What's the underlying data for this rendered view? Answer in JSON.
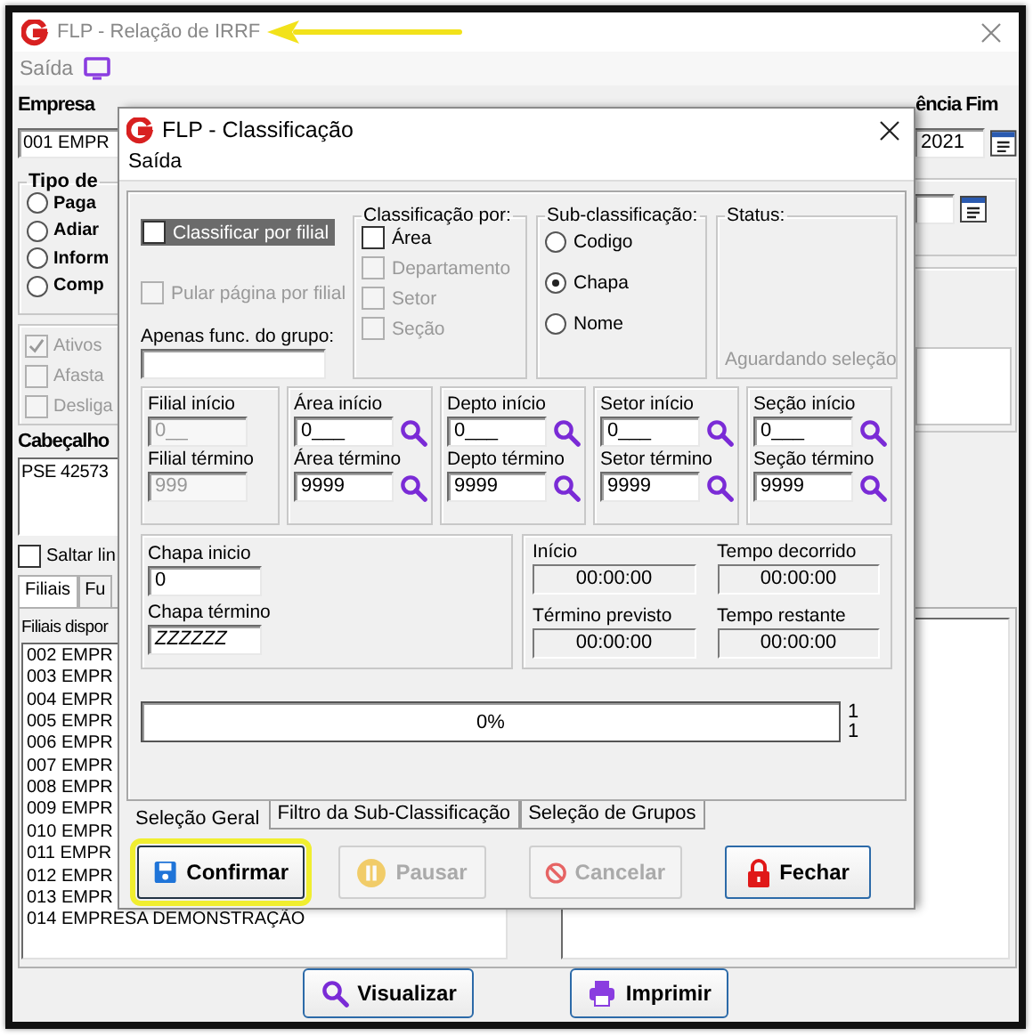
{
  "main_window": {
    "title": "FLP - Relação de IRRF",
    "menu": [
      {
        "label": "Saída"
      }
    ],
    "empresa_label": "Empresa",
    "empresa_value": "001 EMPR",
    "tipo_group": {
      "title": "Tipo de",
      "options": [
        {
          "label": "Paga",
          "selected": false
        },
        {
          "label": "Adiar",
          "selected": false
        },
        {
          "label": "Inform",
          "selected": false
        },
        {
          "label": "Comp",
          "selected": false
        }
      ]
    },
    "situacao": [
      {
        "label": "Ativos",
        "checked": true,
        "disabled": true
      },
      {
        "label": "Afasta",
        "checked": false,
        "disabled": true
      },
      {
        "label": "Desliga",
        "checked": false,
        "disabled": true
      }
    ],
    "cabecalho_label": "Cabeçalho",
    "cabecalho_value": "PSE 42573",
    "saltar": {
      "label": "Saltar lin",
      "checked": false
    },
    "tabs": [
      {
        "label": "Filiais",
        "selected": true
      },
      {
        "label": "Fu",
        "selected": false
      }
    ],
    "list_label": "Filiais dispor",
    "list_items": [
      "002 EMPR",
      "003 EMPR",
      "004 EMPR",
      "005 EMPR",
      "006 EMPR",
      "007 EMPR",
      "008 EMPR",
      "009 EMPR",
      "010 EMPR",
      "011 EMPR",
      "012 EMPR",
      "013 EMPR",
      "014 EMPRESA DEMONSTRAÇÃO"
    ],
    "end_label": "ência Fim",
    "end_value": "2021",
    "buttons": [
      {
        "label": "Visualizar",
        "kind": "search"
      },
      {
        "label": "Imprimir",
        "kind": "print"
      }
    ]
  },
  "dialog": {
    "title": "FLP - Classificação",
    "menu": [
      {
        "label": "Saída"
      }
    ],
    "classificar": {
      "label": "Classificar por filial",
      "checked": false,
      "focused": true
    },
    "pular": {
      "label": "Pular página por filial",
      "checked": false,
      "disabled": true
    },
    "grupo_label": "Apenas func. do grupo:",
    "classificacao": {
      "title": "Classificação por:",
      "options": [
        {
          "label": "Área",
          "checked": false,
          "disabled": false
        },
        {
          "label": "Departamento",
          "checked": false,
          "disabled": true
        },
        {
          "label": "Setor",
          "checked": false,
          "disabled": true
        },
        {
          "label": "Seção",
          "checked": false,
          "disabled": true
        }
      ]
    },
    "sub_classificacao": {
      "title": "Sub-classificação:",
      "options": [
        {
          "label": "Codigo",
          "selected": false
        },
        {
          "label": "Chapa",
          "selected": true
        },
        {
          "label": "Nome",
          "selected": false
        }
      ]
    },
    "status": {
      "title": "Status:",
      "text": "Aguardando seleção"
    },
    "ranges": [
      {
        "start_label": "Filial início",
        "start_value": "0__",
        "end_label": "Filial término",
        "end_value": "999",
        "disabled": true
      },
      {
        "start_label": "Área início",
        "start_value": "0___",
        "end_label": "Área término",
        "end_value": "9999",
        "disabled": false
      },
      {
        "start_label": "Depto início",
        "start_value": "0___",
        "end_label": "Depto término",
        "end_value": "9999",
        "disabled": false
      },
      {
        "start_label": "Setor início",
        "start_value": "0___",
        "end_label": "Setor término",
        "end_value": "9999",
        "disabled": false
      },
      {
        "start_label": "Seção início",
        "start_value": "0___",
        "end_label": "Seção término",
        "end_value": "9999",
        "disabled": false
      }
    ],
    "chapa": {
      "start_label": "Chapa inicio",
      "start_value": "0",
      "end_label": "Chapa término",
      "end_value": "ZZZZZZ"
    },
    "times": [
      {
        "label": "Início",
        "value": "00:00:00"
      },
      {
        "label": "Tempo decorrido",
        "value": "00:00:00"
      },
      {
        "label": "Término previsto",
        "value": "00:00:00"
      },
      {
        "label": "Tempo restante",
        "value": "00:00:00"
      }
    ],
    "progress": {
      "level": 0,
      "text": "0%"
    },
    "counters": [
      "1",
      "1"
    ],
    "tabs": [
      {
        "label": "Seleção Geral",
        "selected": true
      },
      {
        "label": "Filtro da Sub-Classificação",
        "selected": false
      },
      {
        "label": "Seleção de Grupos",
        "selected": false
      }
    ],
    "buttons": [
      {
        "label": "Confirmar",
        "kind": "save",
        "disabled": false,
        "highlighted": true
      },
      {
        "label": "Pausar",
        "kind": "pause",
        "disabled": true,
        "highlighted": false
      },
      {
        "label": "Cancelar",
        "kind": "cancel",
        "disabled": true,
        "highlighted": false
      },
      {
        "label": "Fechar",
        "kind": "lock",
        "disabled": false,
        "highlighted": false
      }
    ]
  }
}
